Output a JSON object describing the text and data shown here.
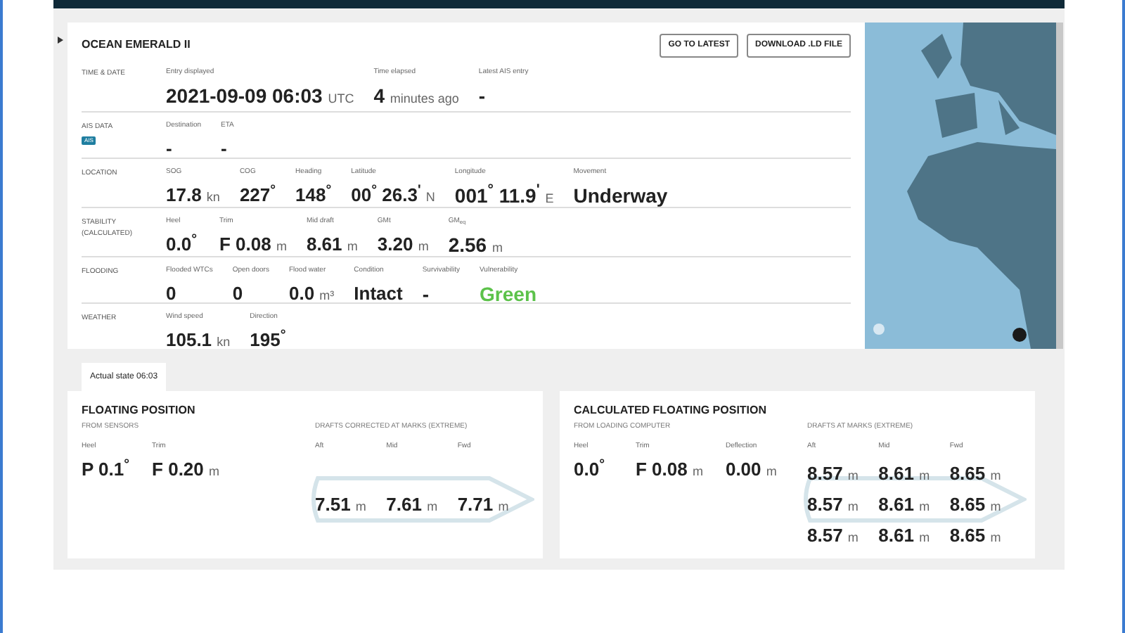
{
  "vessel": {
    "name": "OCEAN EMERALD II",
    "buttons": [
      "GO TO LATEST",
      "DOWNLOAD .LD FILE"
    ]
  },
  "sections": [
    {
      "label": "TIME & DATE",
      "fields": [
        {
          "label": "Entry displayed",
          "value": "2021-09-09 06:03",
          "unit": "UTC"
        },
        {
          "label": "Time elapsed",
          "value": "4",
          "unit": "minutes ago"
        },
        {
          "label": "Latest AIS entry",
          "value": "-"
        }
      ]
    },
    {
      "label": "AIS DATA",
      "badge": "AIS",
      "fields": [
        {
          "label": "Destination",
          "value": "-"
        },
        {
          "label": "ETA",
          "value": "-"
        }
      ]
    },
    {
      "label": "LOCATION",
      "fields": [
        {
          "label": "SOG",
          "value": "17.8",
          "unit": "kn"
        },
        {
          "label": "COG",
          "value": "227$^{°}$"
        },
        {
          "label": "Heading",
          "value": "148$^{°}$"
        },
        {
          "label": "Latitude",
          "value": "00$^{°}$ 26.3$^{'}$",
          "unit": "N"
        },
        {
          "label": "Longitude",
          "value": "001$^{°}$ 11.9$^{'}$",
          "unit": "E"
        },
        {
          "label": "Movement",
          "value": "Underway"
        }
      ]
    },
    {
      "label": "STABILITY (CALCULATED)",
      "fields": [
        {
          "label": "Heel",
          "value": "0.0$^{°}$"
        },
        {
          "label": "Trim",
          "value": "F 0.08",
          "unit": "m"
        },
        {
          "label": "Mid draft",
          "value": "8.61",
          "unit": "m"
        },
        {
          "label": "GMt",
          "value": "3.20",
          "unit": "m"
        },
        {
          "label": "GM$_{eq}$",
          "value": "2.56",
          "unit": "m"
        }
      ]
    },
    {
      "label": "FLOODING",
      "fields": [
        {
          "label": "Flooded WTCs",
          "value": "0"
        },
        {
          "label": "Open doors",
          "value": "0"
        },
        {
          "label": "Flood water",
          "value": "0.0",
          "unit": "m³"
        },
        {
          "label": "Condition",
          "value": "Intact"
        },
        {
          "label": "Survivability",
          "value": "-"
        },
        {
          "label": "Vulnerability",
          "value": "Green",
          "color": "#5cc24a"
        }
      ]
    },
    {
      "label": "WEATHER",
      "fields": [
        {
          "label": "Wind speed",
          "value": "105.1",
          "unit": "kn"
        },
        {
          "label": "Direction",
          "value": "195$^{°}$"
        }
      ]
    }
  ],
  "tabs": [
    {
      "label": "Actual state 06:03",
      "selected": true
    }
  ],
  "panels": [
    {
      "title": "FLOATING POSITION",
      "subtitle": "FROM SENSORS",
      "fields": [
        {
          "label": "Heel",
          "value": "P 0.1$^{°}$"
        },
        {
          "label": "Trim",
          "value": "F 0.20",
          "unit": "m"
        }
      ],
      "drafts": {
        "title": "DRAFTS CORRECTED AT MARKS (EXTREME)",
        "columns": [
          "Aft",
          "Mid",
          "Fwd"
        ],
        "rows": [
          [
            {
              "value": "7.51",
              "unit": "m"
            },
            {
              "value": "7.61",
              "unit": "m"
            },
            {
              "value": "7.71",
              "unit": "m"
            }
          ]
        ]
      }
    },
    {
      "title": "CALCULATED FLOATING POSITION",
      "subtitle": "FROM LOADING COMPUTER",
      "fields": [
        {
          "label": "Heel",
          "value": "0.0$^{°}$"
        },
        {
          "label": "Trim",
          "value": "F 0.08",
          "unit": "m"
        },
        {
          "label": "Deflection",
          "value": "0.00",
          "unit": "m"
        }
      ],
      "drafts": {
        "title": "DRAFTS AT MARKS (EXTREME)",
        "columns": [
          "Aft",
          "Mid",
          "Fwd"
        ],
        "rows": [
          [
            {
              "value": "8.57",
              "unit": "m"
            },
            {
              "value": "8.61",
              "unit": "m"
            },
            {
              "value": "8.65",
              "unit": "m"
            }
          ],
          [
            {
              "value": "8.57",
              "unit": "m"
            },
            {
              "value": "8.61",
              "unit": "m"
            },
            {
              "value": "8.65",
              "unit": "m"
            }
          ],
          [
            {
              "value": "8.57",
              "unit": "m"
            },
            {
              "value": "8.61",
              "unit": "m"
            },
            {
              "value": "8.65",
              "unit": "m"
            }
          ]
        ]
      }
    }
  ]
}
